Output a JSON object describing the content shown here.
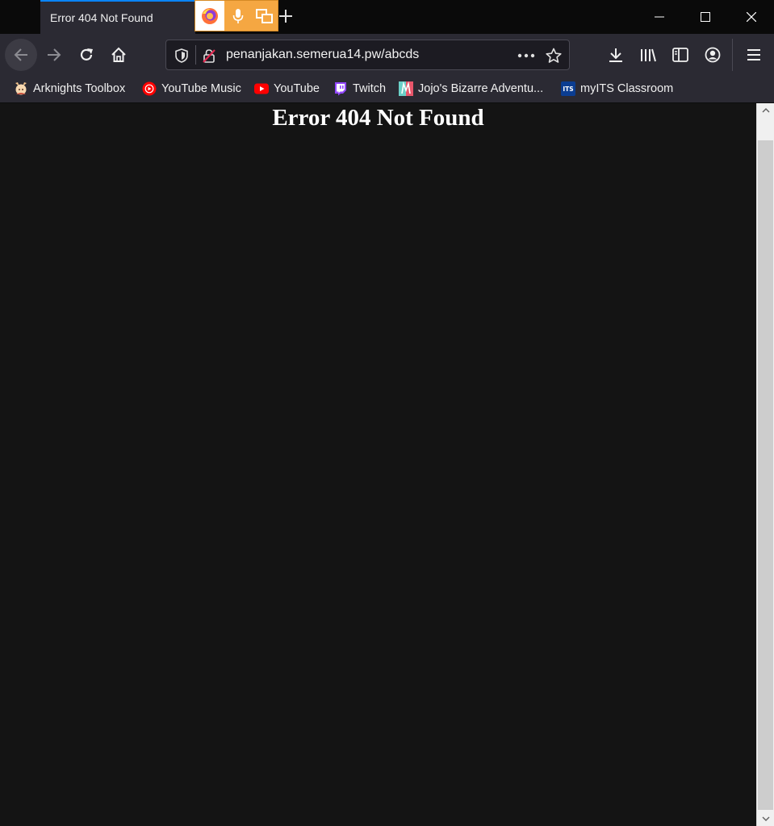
{
  "tab": {
    "title": "Error 404 Not Found"
  },
  "extensions": [
    {
      "icon": "firefox-icon"
    },
    {
      "icon": "microphone-icon"
    },
    {
      "icon": "picture-in-picture-icon"
    }
  ],
  "window_controls": {
    "icons": [
      "minimize-icon",
      "maximize-icon",
      "close-icon"
    ]
  },
  "nav": {
    "icons": [
      "back-arrow-icon",
      "forward-arrow-icon",
      "reload-icon",
      "home-icon"
    ]
  },
  "urlbar": {
    "url": "penanjakan.semerua14.pw/abcds",
    "icons": [
      "tracking-shield-icon",
      "insecure-lock-icon",
      "page-actions-icon",
      "bookmark-star-icon"
    ]
  },
  "toolbar": {
    "icons": [
      "download-icon",
      "library-icon",
      "sidebar-icon",
      "account-icon",
      "hamburger-menu-icon"
    ]
  },
  "bookmarks": [
    {
      "label": "Arknights Toolbox",
      "icon": "arknights-favicon"
    },
    {
      "label": "YouTube Music",
      "icon": "youtube-music-favicon"
    },
    {
      "label": "YouTube",
      "icon": "youtube-favicon"
    },
    {
      "label": "Twitch",
      "icon": "twitch-favicon"
    },
    {
      "label": "Jojo's Bizarre Adventu...",
      "icon": "jojo-favicon"
    },
    {
      "label": "myITS Classroom",
      "icon": "myits-favicon"
    }
  ],
  "page": {
    "heading": "Error 404 Not Found"
  },
  "colors": {
    "accent_tab": "#0a84ff",
    "extension_bg": "#f5a742",
    "page_bg": "#141414",
    "toolbar_bg": "#2b2a33"
  }
}
